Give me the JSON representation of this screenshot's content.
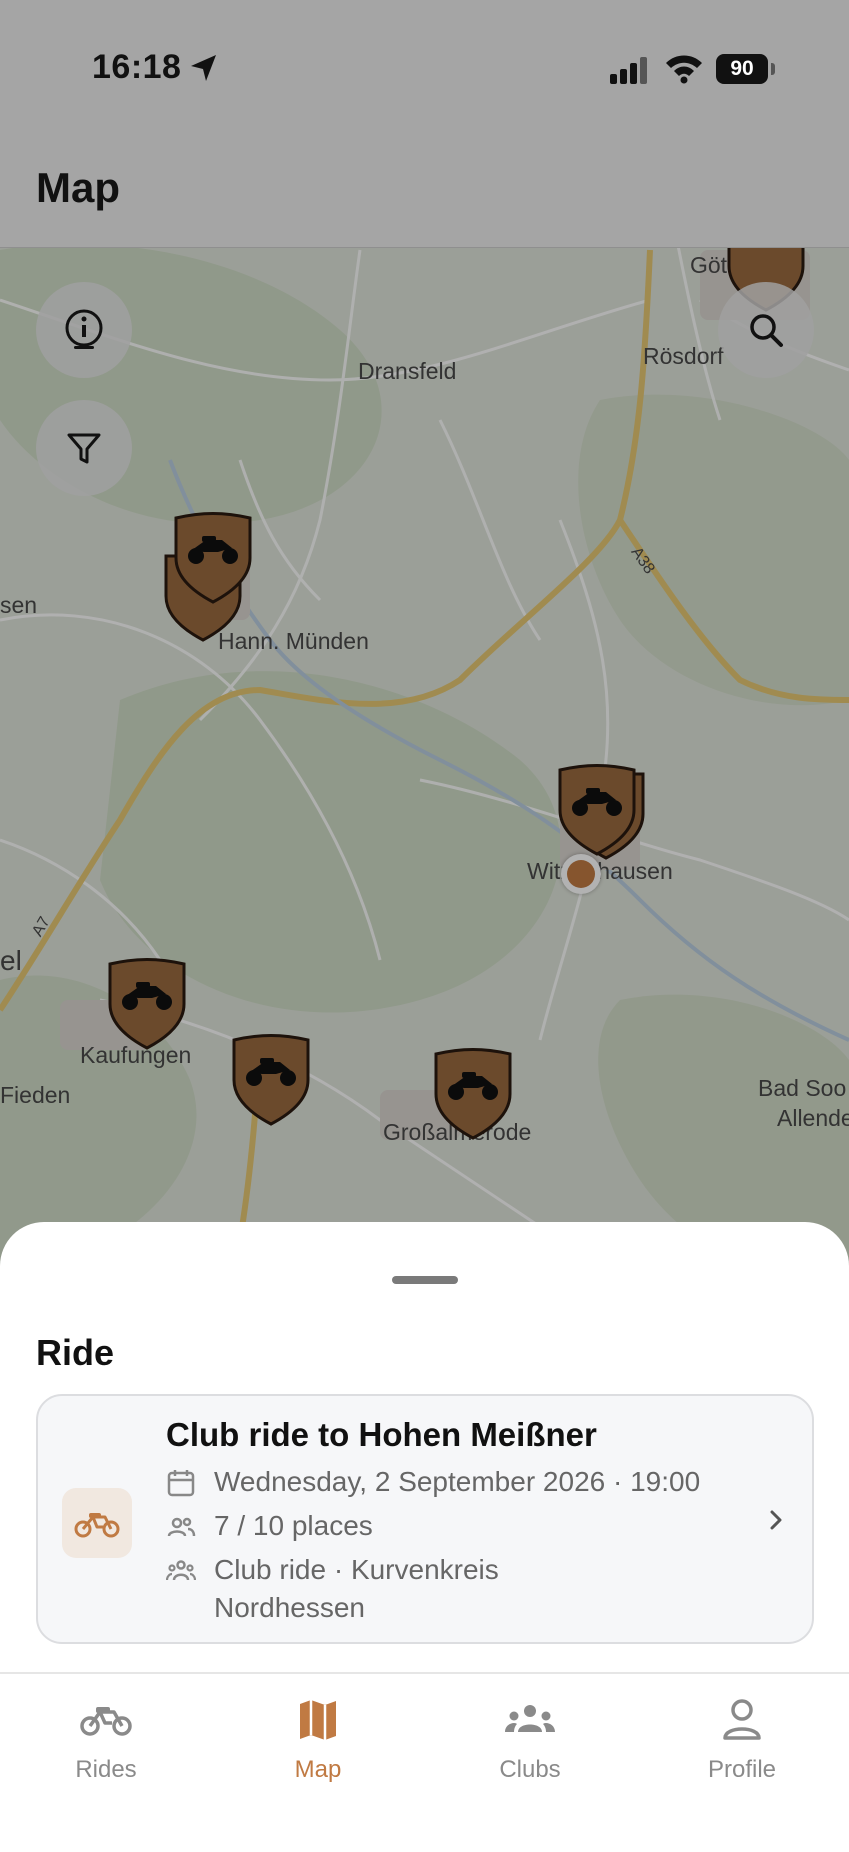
{
  "status_bar": {
    "time": "16:18",
    "battery": "90"
  },
  "header": {
    "title": "Map"
  },
  "map": {
    "places": {
      "gottingen": "Göttingen",
      "rosdorf": "Rösdorf",
      "dransfeld": "Dransfeld",
      "sen": "sen",
      "hann_munden": "Hann. Münden",
      "witzenhausen": "Witzenhausen",
      "kaufungen": "Kaufungen",
      "fieden": "Fieden",
      "el": "el",
      "grossalmerode": "Großalmerode",
      "bad_sooden": "Bad Soo",
      "allende": "Allende",
      "road_a7": "A7",
      "road_a38": "A38"
    }
  },
  "sheet": {
    "title": "Ride",
    "ride": {
      "title": "Club ride to Hohen Meißner",
      "date": "Wednesday, 2 September 2026 · 19:00",
      "places": "7 / 10 places",
      "club_line1": "Club ride · Kurvenkreis",
      "club_line2": "Nordhessen"
    }
  },
  "tabs": [
    {
      "label": "Rides",
      "icon": "motorcycle-icon",
      "active": false
    },
    {
      "label": "Map",
      "icon": "map-icon",
      "active": true
    },
    {
      "label": "Clubs",
      "icon": "clubs-icon",
      "active": false
    },
    {
      "label": "Profile",
      "icon": "profile-icon",
      "active": false
    }
  ],
  "colors": {
    "accent": "#c07a43",
    "pin": "#8a5a33"
  }
}
